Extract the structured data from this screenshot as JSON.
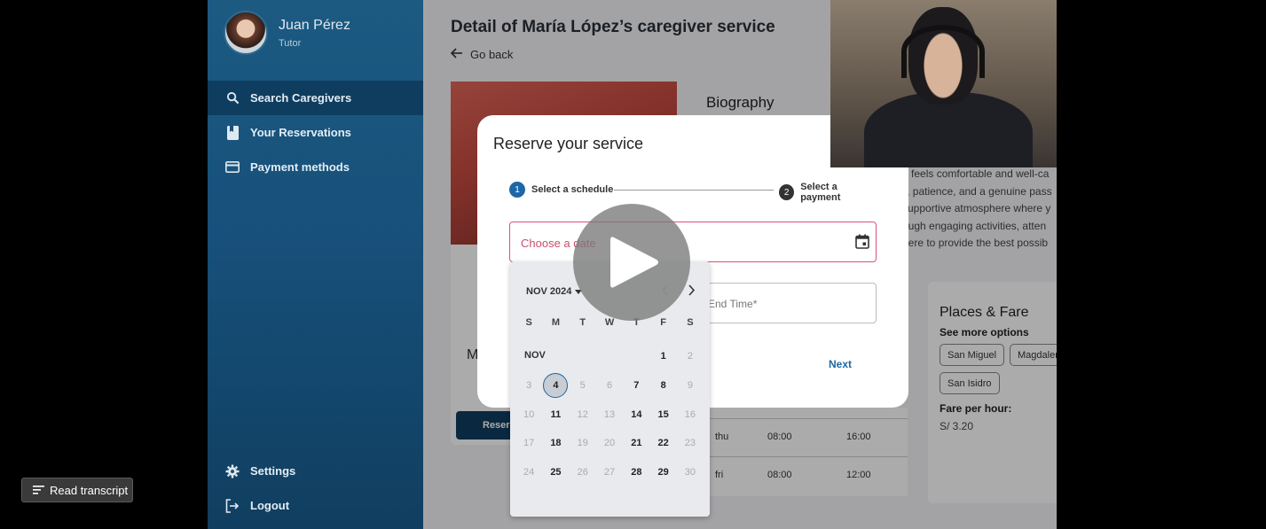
{
  "sidebar": {
    "user_name": "Juan Pérez",
    "user_role": "Tutor",
    "items": [
      {
        "label": "Search Caregivers",
        "icon": "search-icon"
      },
      {
        "label": "Your Reservations",
        "icon": "bookmark-icon"
      },
      {
        "label": "Payment methods",
        "icon": "credit-card-icon"
      }
    ],
    "bottom_items": [
      {
        "label": "Settings",
        "icon": "gear-icon"
      },
      {
        "label": "Logout",
        "icon": "logout-icon"
      }
    ]
  },
  "page": {
    "title": "Detail of María López’s caregiver service",
    "go_back": "Go back",
    "name_initial": "M",
    "reserve_button": "Reser",
    "biography_title": "Biography",
    "biography_lines": [
      "e feels comfortable and well-ca",
      "y, patience, and a genuine pass",
      "supportive atmosphere where y",
      "ough engaging activities, atten",
      "here to provide the best possib"
    ],
    "schedule": [
      {
        "day": "thu",
        "start": "08:00",
        "end": "16:00"
      },
      {
        "day": "fri",
        "start": "08:00",
        "end": "12:00"
      }
    ],
    "places_title": "Places & Fare",
    "see_more": "See more options",
    "places": [
      "San Miguel",
      "Magdalen",
      "San Isidro"
    ],
    "fare_label": "Fare per hour:",
    "fare_value": "S/ 3.20"
  },
  "dialog": {
    "title": "Reserve your service",
    "steps": [
      {
        "num": "1",
        "label": "Select a schedule"
      },
      {
        "num": "2",
        "label": "Select a payment"
      }
    ],
    "date_placeholder": "Choose a date",
    "end_time_placeholder": "End Time*",
    "next_label": "Next"
  },
  "calendar": {
    "month_year": "NOV 2024",
    "month_label": "NOV",
    "weekdays": [
      "S",
      "M",
      "T",
      "W",
      "T",
      "F",
      "S"
    ],
    "selected_day": "4"
  },
  "player": {
    "transcript_label": "Read transcript"
  },
  "colors": {
    "sidebar_bg": "#17507a",
    "active_nav": "#0f3d5f",
    "accent": "#1d67a6",
    "error": "#d9527a"
  }
}
